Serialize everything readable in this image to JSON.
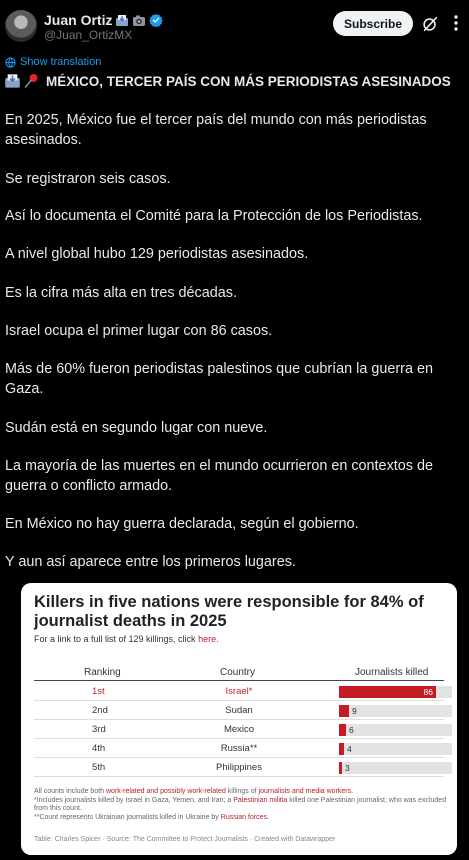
{
  "post": {
    "author_name": "Juan Ortiz",
    "handle": "@Juan_OrtizMX",
    "subscribe_label": "Subscribe",
    "show_translation": "Show translation",
    "title": "MÉXICO, TERCER PAÍS CON MÁS PERIODISTAS ASESINADOS",
    "paragraphs": [
      "En 2025, México fue el tercer país del mundo con más periodistas asesinados.",
      "Se registraron seis casos.",
      "Así lo documenta el Comité para la Protección de los Periodistas.",
      "A nivel global hubo 129 periodistas asesinados.",
      "Es la cifra más alta en tres décadas.",
      "Israel ocupa el primer lugar con 86 casos.",
      "Más de 60% fueron periodistas palestinos que cubrían la guerra en Gaza.",
      "Sudán está en segundo lugar con nueve.",
      "La mayoría de las muertes en el mundo ocurrieron en contextos de guerra o conflicto armado.",
      "En México no hay guerra declarada, según el gobierno.",
      "Y aun así aparece entre los primeros lugares."
    ]
  },
  "icons": {
    "emoji_1": "inbox-tray-icon",
    "emoji_2": "camera-icon",
    "verified": "verified-badge-icon",
    "grok": "grok-icon",
    "more": "more-options-icon",
    "translate": "translate-globe-icon",
    "title_emoji_1": "inbox-tray-icon",
    "title_emoji_2": "pushpin-icon"
  },
  "colors": {
    "background": "#000000",
    "text": "#e7e9ea",
    "muted": "#71767b",
    "link": "#1d9bf0",
    "chart_red": "#c61b23"
  },
  "card": {
    "title": "Killers in five nations were responsible for 84% of journalist deaths in 2025",
    "subtitle_prefix": "For a link to a full list of 129 killings, click ",
    "subtitle_link": "here.",
    "note_1_a": "All counts include both ",
    "note_1_b": "work-related and possibly work-related",
    "note_1_c": " killings of ",
    "note_1_d": "journalists and media workers.",
    "note_2_a": "*Includes journalists killed by Israel in Gaza, Yemen, and Iran; a ",
    "note_2_b": "Palestinian militia",
    "note_2_c": " killed one Palestinian journalist, who was excluded from this count.",
    "note_3_a": "**Count represents Ukrainian journalists killed in Ukraine by ",
    "note_3_b": "Russian forces.",
    "source": "Table: Charles Spicer · Source: The Committee to Protect Journalists · Created with Datawrapper"
  },
  "chart_data": {
    "type": "table",
    "title": "Killers in five nations were responsible for 84% of journalist deaths in 2025",
    "columns": [
      "Ranking",
      "Country",
      "Journalists killed"
    ],
    "rows": [
      {
        "rank": "1st",
        "country": "Israel*",
        "killed": 86
      },
      {
        "rank": "2nd",
        "country": "Sudan",
        "killed": 9
      },
      {
        "rank": "3rd",
        "country": "Mexico",
        "killed": 6
      },
      {
        "rank": "4th",
        "country": "Russia**",
        "killed": 4
      },
      {
        "rank": "5th",
        "country": "Philippines",
        "killed": 3
      }
    ],
    "bar_max": 100
  }
}
